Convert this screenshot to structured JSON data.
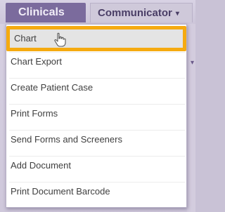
{
  "tabs": {
    "clinicals": "Clinicals",
    "communicator": "Communicator"
  },
  "icons": {
    "communicator_caret": "▾",
    "cursor": "hand-pointer-icon"
  },
  "menu": {
    "items": [
      {
        "label": "Chart",
        "highlighted": true
      },
      {
        "label": "Chart Export",
        "highlighted": false
      },
      {
        "label": "Create Patient Case",
        "highlighted": false
      },
      {
        "label": "Print Forms",
        "highlighted": false
      },
      {
        "label": "Send Forms and Screeners",
        "highlighted": false
      },
      {
        "label": "Add Document",
        "highlighted": false
      },
      {
        "label": "Print Document Barcode",
        "highlighted": false
      }
    ]
  },
  "colors": {
    "highlight_border": "#f5aa10",
    "tab_active": "#7b6b9d",
    "tab_text": "#4a3e66"
  }
}
